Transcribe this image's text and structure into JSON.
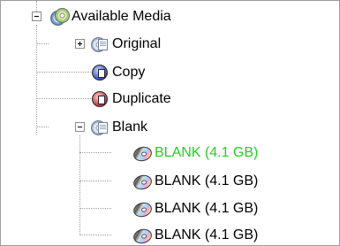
{
  "tree": {
    "root": {
      "label": "Available Media",
      "icon": "discs-icon",
      "expanded": true
    },
    "children": [
      {
        "label": "Original",
        "icon": "disc-document-icon",
        "expanded": false,
        "has_children": true
      },
      {
        "label": "Copy",
        "icon": "copy-badge-icon",
        "has_children": false
      },
      {
        "label": "Duplicate",
        "icon": "duplicate-badge-icon",
        "has_children": false
      },
      {
        "label": "Blank",
        "icon": "disc-document-icon",
        "expanded": true,
        "has_children": true
      }
    ],
    "blank_items": [
      {
        "label": "BLANK (4.1 GB)",
        "icon": "blank-disc-icon",
        "selected_color": "#1fd11f"
      },
      {
        "label": "BLANK (4.1 GB)",
        "icon": "blank-disc-icon"
      },
      {
        "label": "BLANK (4.1 GB)",
        "icon": "blank-disc-icon"
      },
      {
        "label": "BLANK (4.1 GB)",
        "icon": "blank-disc-icon"
      }
    ]
  }
}
